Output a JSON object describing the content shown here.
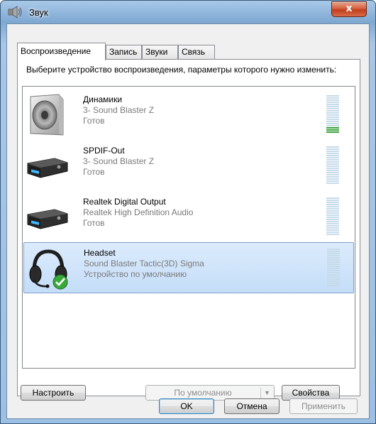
{
  "window": {
    "title": "Звук",
    "close_glyph": "x"
  },
  "tabs": [
    {
      "label": "Воспроизведение",
      "active": true
    },
    {
      "label": "Запись"
    },
    {
      "label": "Звуки"
    },
    {
      "label": "Связь"
    }
  ],
  "instruction": "Выберите устройство воспроизведения, параметры которого нужно изменить:",
  "devices": [
    {
      "name": "Динамики",
      "driver": "3- Sound Blaster Z",
      "status": "Готов",
      "icon": "speaker-icon",
      "level_active_segments": 3
    },
    {
      "name": "SPDIF-Out",
      "driver": "3- Sound Blaster Z",
      "status": "Готов",
      "icon": "digital-output-icon",
      "level_active_segments": 0
    },
    {
      "name": "Realtek Digital Output",
      "driver": "Realtek High Definition Audio",
      "status": "Готов",
      "icon": "digital-output-icon",
      "level_active_segments": 0
    },
    {
      "name": "Headset",
      "driver": "Sound Blaster Tactic(3D) Sigma",
      "status": "Устройство по умолчанию",
      "icon": "headset-icon",
      "default_badge": "checkmark-icon",
      "level_active_segments": 0,
      "selected": true
    }
  ],
  "buttons": {
    "configure": "Настроить",
    "set_default": "По умолчанию",
    "properties": "Свойства",
    "ok": "OK",
    "cancel": "Отмена",
    "apply": "Применить"
  },
  "colors": {
    "selection": "#cce4f7",
    "level_active": "#3aa23a",
    "level_idle": "#c6dbe9"
  }
}
